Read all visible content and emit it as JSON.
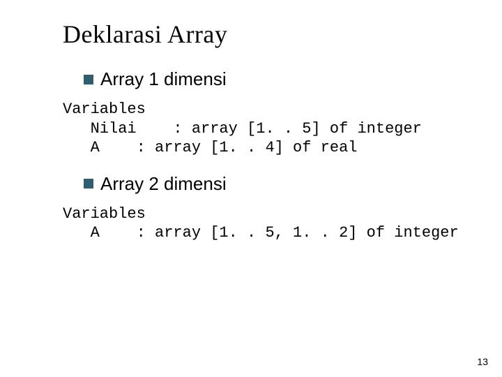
{
  "title": "Deklarasi Array",
  "bullets": {
    "first": "Array 1 dimensi",
    "second": "Array 2 dimensi"
  },
  "code1": "Variables\n   Nilai    : array [1. . 5] of integer\n   A    : array [1. . 4] of real",
  "code2": "Variables\n   A    : array [1. . 5, 1. . 2] of integer",
  "page_number": "13"
}
